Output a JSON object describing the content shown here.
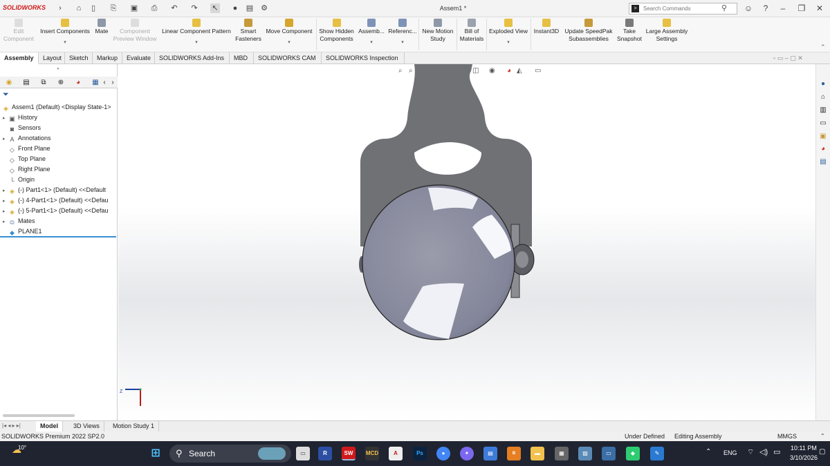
{
  "titlebar": {
    "app_name": "SOLIDWORKS",
    "document_title": "Assem1 *",
    "search_placeholder": "Search Commands"
  },
  "ribbon": {
    "buttons": [
      {
        "label": "Edit Component",
        "disabled": true
      },
      {
        "label": "Insert Components",
        "disabled": false
      },
      {
        "label": "Mate",
        "disabled": false
      },
      {
        "label": "Component Preview Window",
        "disabled": true
      },
      {
        "label": "Linear Component Pattern",
        "disabled": false
      },
      {
        "label": "Smart Fasteners",
        "disabled": false
      },
      {
        "label": "Move Component",
        "disabled": false
      },
      {
        "label": "Show Hidden Components",
        "disabled": false
      },
      {
        "label": "Assemb...",
        "disabled": false
      },
      {
        "label": "Referenc...",
        "disabled": false
      },
      {
        "label": "New Motion Study",
        "disabled": false
      },
      {
        "label": "Bill of Materials",
        "disabled": false
      },
      {
        "label": "Exploded View",
        "disabled": false
      },
      {
        "label": "Instant3D",
        "disabled": false
      },
      {
        "label": "Update SpeedPak Subassemblies",
        "disabled": false
      },
      {
        "label": "Take Snapshot",
        "disabled": false
      },
      {
        "label": "Large Assembly Settings",
        "disabled": false
      }
    ]
  },
  "tabs": [
    "Assembly",
    "Layout",
    "Sketch",
    "Markup",
    "Evaluate",
    "SOLIDWORKS Add-Ins",
    "MBD",
    "SOLIDWORKS CAM",
    "SOLIDWORKS Inspection"
  ],
  "tree": {
    "root": "Assem1 (Default) <Display State-1>",
    "items": [
      {
        "label": "History",
        "expandable": true,
        "icon": "history-icon"
      },
      {
        "label": "Sensors",
        "expandable": false,
        "icon": "sensors-icon"
      },
      {
        "label": "Annotations",
        "expandable": true,
        "icon": "annotations-icon"
      },
      {
        "label": "Front Plane",
        "expandable": false,
        "icon": "plane-icon"
      },
      {
        "label": "Top Plane",
        "expandable": false,
        "icon": "plane-icon"
      },
      {
        "label": "Right Plane",
        "expandable": false,
        "icon": "plane-icon"
      },
      {
        "label": "Origin",
        "expandable": false,
        "icon": "origin-icon"
      },
      {
        "label": "(-) Part1<1> (Default) <<Default",
        "expandable": true,
        "icon": "part-icon"
      },
      {
        "label": "(-) 4-Part1<1> (Default) <<Defau",
        "expandable": true,
        "icon": "part-icon"
      },
      {
        "label": "(-) 5-Part1<1> (Default) <<Defau",
        "expandable": true,
        "icon": "part-icon"
      },
      {
        "label": "Mates",
        "expandable": true,
        "icon": "mates-icon"
      },
      {
        "label": "PLANE1",
        "expandable": false,
        "icon": "plane-feature-icon"
      }
    ]
  },
  "bottom_tabs": [
    "Model",
    "3D Views",
    "Motion Study 1"
  ],
  "status": {
    "product": "SOLIDWORKS Premium 2022 SP2.0",
    "state": "Under Defined",
    "mode": "Editing Assembly",
    "units": "MMGS"
  },
  "taskbar": {
    "weather": "10°",
    "search_label": "Search",
    "language": "ENG",
    "time": "10:11 PM",
    "date": "3/10/2026"
  },
  "colors": {
    "accent": "#d01a1a",
    "selection": "#3a8fd1",
    "part_gray": "#6f7175",
    "sphere": "#8d8f9e"
  }
}
